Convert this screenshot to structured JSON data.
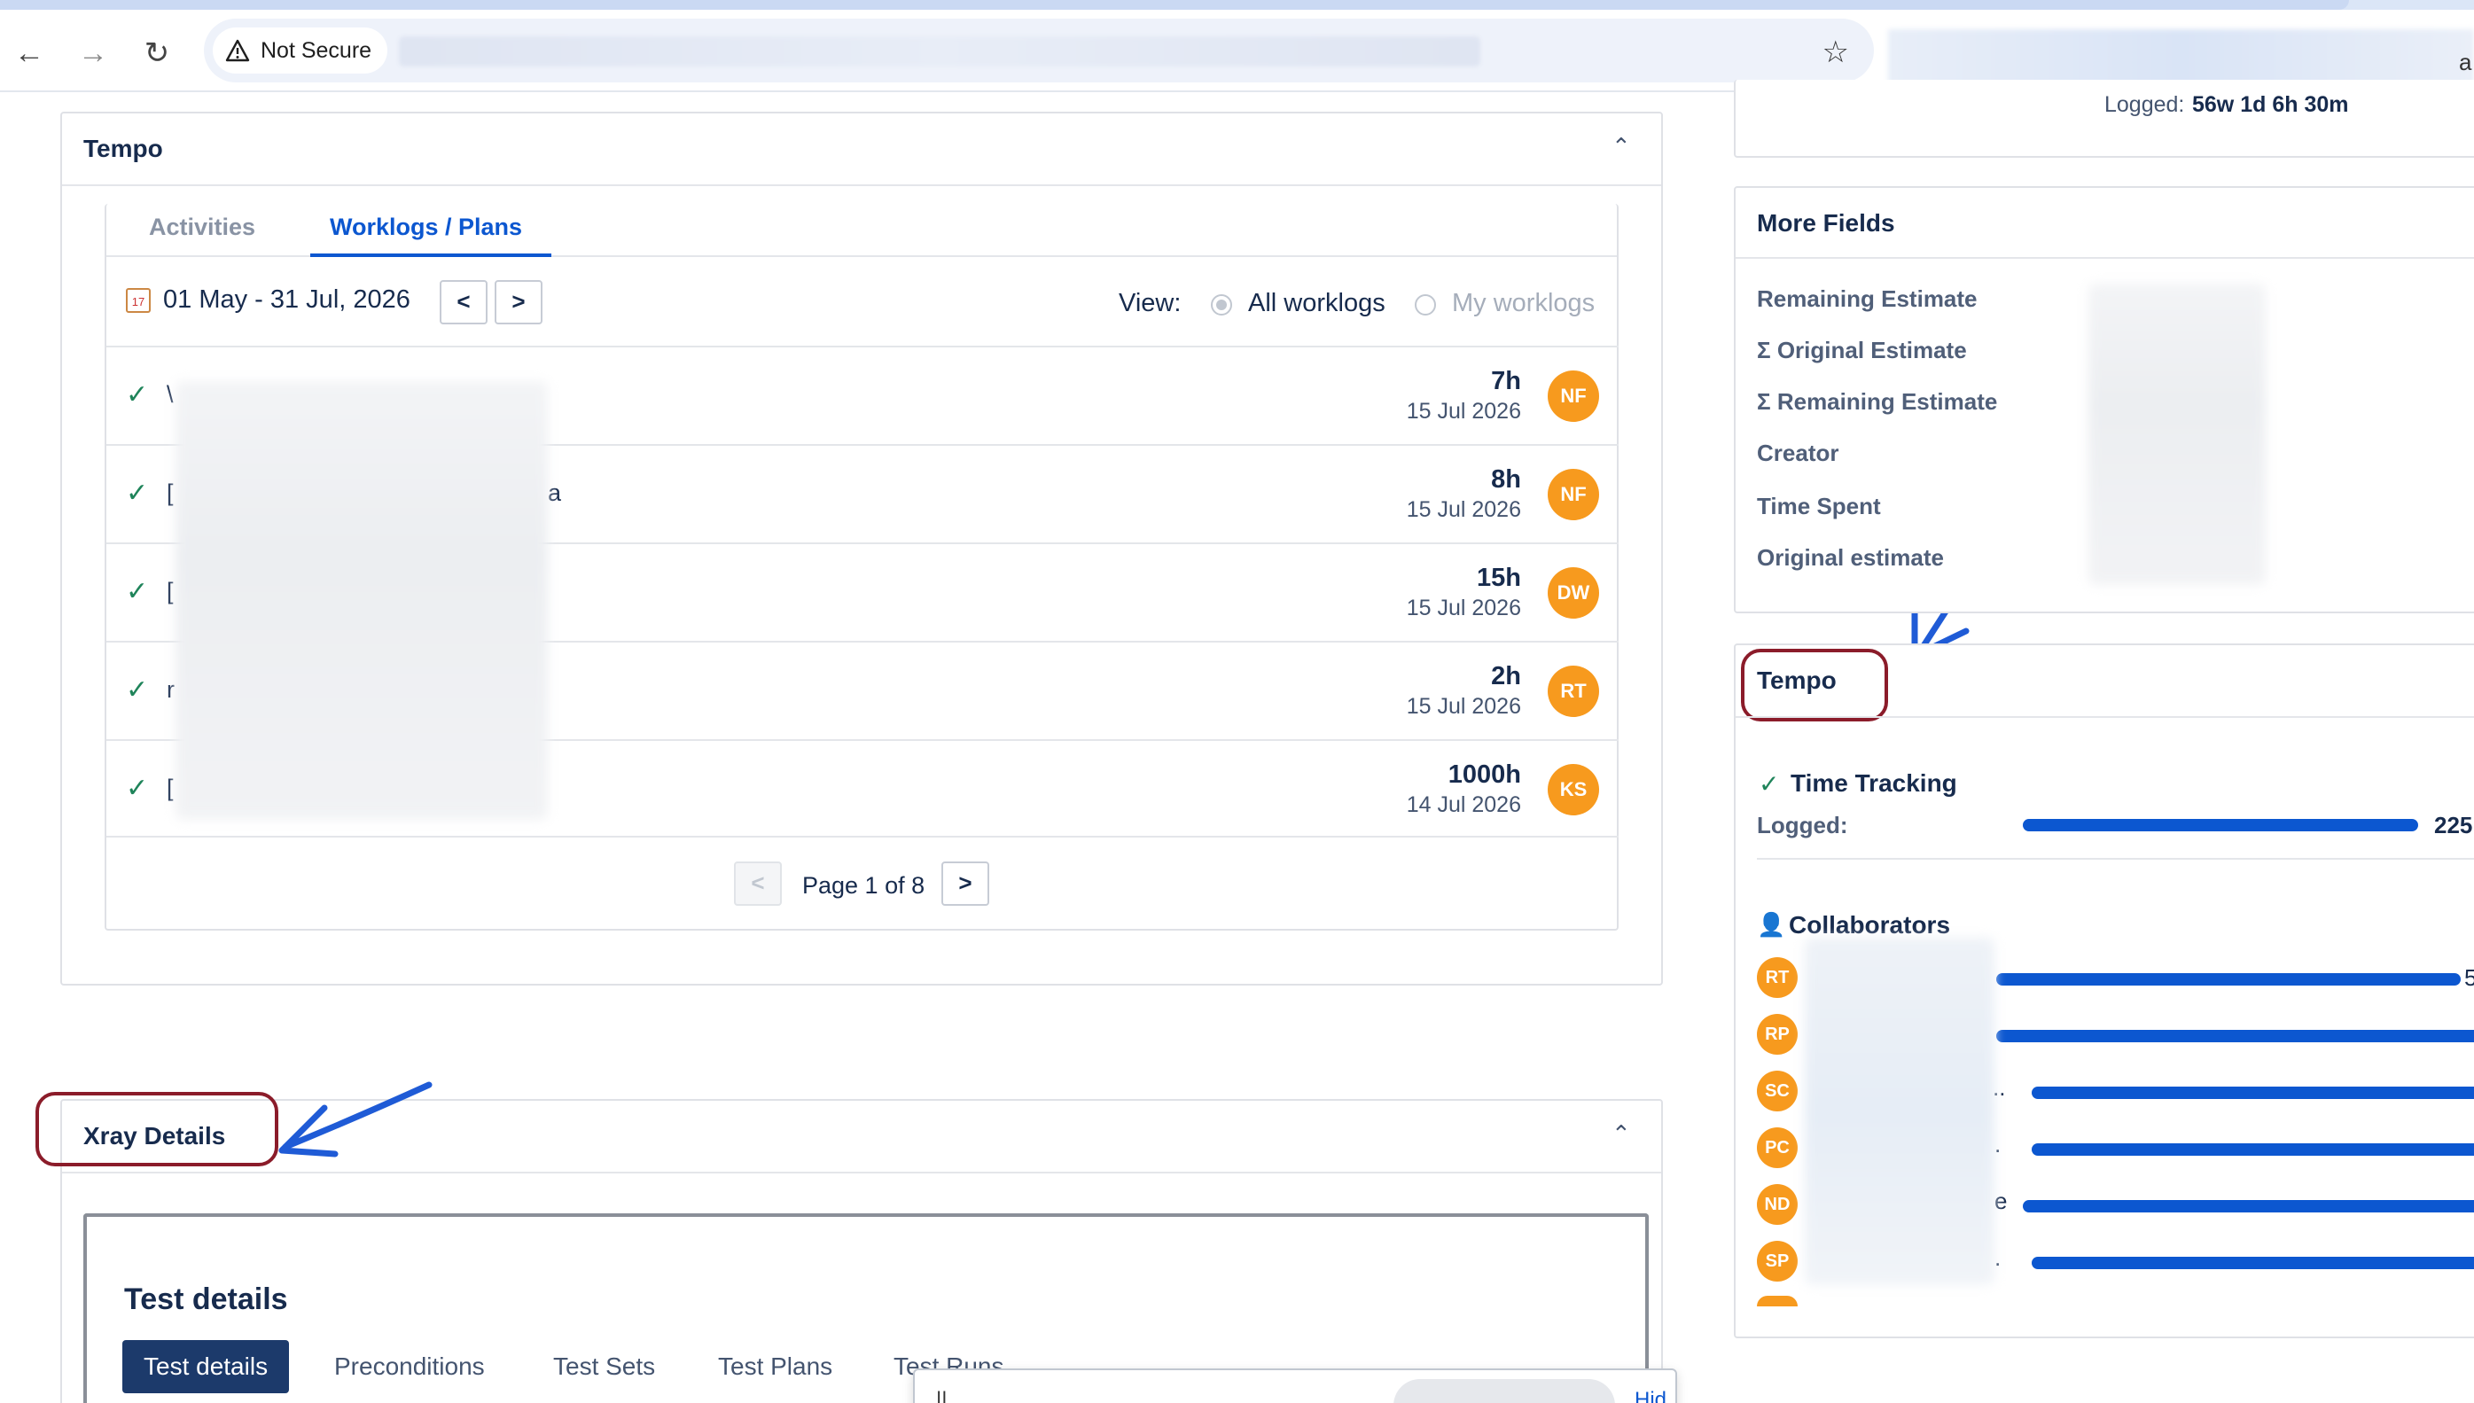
{
  "browser": {
    "security_label": "Not Secure",
    "url": "",
    "profile_tail": "a"
  },
  "tempo_panel": {
    "title": "Tempo",
    "tabs": [
      {
        "label": "Activities",
        "active": false
      },
      {
        "label": "Worklogs / Plans",
        "active": true
      }
    ],
    "date_range": "01 May - 31 Jul, 2026",
    "prev_label": "<",
    "next_label": ">",
    "view_label": "View:",
    "view_options": [
      {
        "label": "All worklogs",
        "checked": true
      },
      {
        "label": "My worklogs",
        "checked": false
      }
    ],
    "worklogs": [
      {
        "desc": "\\",
        "desc_tail": "",
        "hours": "7h",
        "date": "15 Jul 2026",
        "user": "NF"
      },
      {
        "desc": "[",
        "desc_tail": "a",
        "hours": "8h",
        "date": "15 Jul 2026",
        "user": "NF"
      },
      {
        "desc": "[",
        "desc_tail": "",
        "hours": "15h",
        "date": "15 Jul 2026",
        "user": "DW"
      },
      {
        "desc": "r",
        "desc_tail": "",
        "hours": "2h",
        "date": "15 Jul 2026",
        "user": "RT"
      },
      {
        "desc": "[",
        "desc_tail": "",
        "hours": "1000h",
        "date": "14 Jul 2026",
        "user": "KS"
      }
    ],
    "pagination": {
      "prev": "<",
      "label": "Page 1 of 8",
      "next": ">"
    }
  },
  "xray_panel": {
    "title": "Xray Details",
    "card_title": "Test details",
    "tabs": [
      {
        "label": "Test details",
        "active": true
      },
      {
        "label": "Preconditions",
        "active": false
      },
      {
        "label": "Test Sets",
        "active": false
      },
      {
        "label": "Test Plans",
        "active": false
      },
      {
        "label": "Test Runs",
        "active": false
      }
    ],
    "popover_text": "||       ",
    "popover_link": "Hid"
  },
  "right_column": {
    "logged_top_label": "Logged:",
    "logged_top_value": "56w 1d 6h 30m",
    "more_fields": {
      "title": "More Fields",
      "fields": [
        "Remaining Estimate",
        "Σ Original Estimate",
        "Σ Remaining Estimate",
        "Creator",
        "Time Spent",
        "Original estimate"
      ]
    },
    "tempo": {
      "title": "Tempo",
      "time_tracking_label": "Time Tracking",
      "logged_label": "Logged:",
      "logged_value_partial": "225",
      "logged_fraction": 0.92,
      "collaborators_label": "Collaborators",
      "collaborators": [
        {
          "initials": "RT",
          "tail": "",
          "value_tail": "5",
          "fraction": 1.0
        },
        {
          "initials": "RP",
          "tail": "",
          "value_tail": "",
          "fraction": 1.0
        },
        {
          "initials": "SC",
          "tail": "..",
          "value_tail": "",
          "fraction": 1.0
        },
        {
          "initials": "PC",
          "tail": ".",
          "value_tail": "",
          "fraction": 1.0
        },
        {
          "initials": "ND",
          "tail": "e",
          "value_tail": "",
          "fraction": 1.0
        },
        {
          "initials": "SP",
          "tail": ".",
          "value_tail": "",
          "fraction": 1.0
        }
      ]
    }
  },
  "colors": {
    "accent": "#0c57d0",
    "avatar": "#f79a1e",
    "annotation_oval": "#8b1c2a",
    "annotation_arrow": "#1f5bd6",
    "check": "#1f845a"
  },
  "icons": [
    "back-arrow-icon",
    "forward-arrow-icon",
    "reload-icon",
    "warning-icon",
    "star-icon",
    "chevron-up-icon",
    "calendar-icon",
    "check-icon",
    "person-icon"
  ]
}
